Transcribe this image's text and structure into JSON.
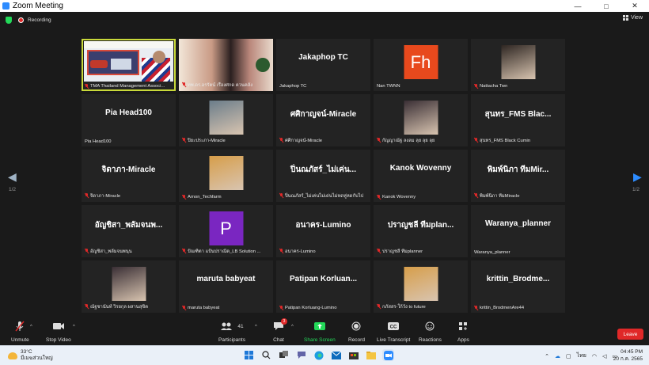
{
  "window": {
    "title": "Zoom Meeting",
    "min": "—",
    "max": "□",
    "close": "✕"
  },
  "topbar": {
    "recording_label": "Recording",
    "view_label": "View"
  },
  "pagination": {
    "left": "1/2",
    "right": "1/2"
  },
  "tiles": [
    {
      "type": "share",
      "name": "TMA Thailand Management Associ..."
    },
    {
      "type": "photo",
      "name": "ทพ.ดร.อรรัตน์ เรืองศกด ควนคลัง"
    },
    {
      "type": "text",
      "big": "Jakaphop TC",
      "name": "Jakaphop TC",
      "muted": false
    },
    {
      "type": "letter",
      "letter": "Fh",
      "color": "#e8491d",
      "name": "Nan TWNN",
      "muted": false
    },
    {
      "type": "photo",
      "name": "Nattacha Twn",
      "muted": true
    },
    {
      "type": "text",
      "big": "Pia Head100",
      "name": "Pia Head100",
      "muted": false
    },
    {
      "type": "photo",
      "name": "ปิยะประภา-Miracle",
      "muted": true
    },
    {
      "type": "text",
      "big": "ศศิกาญจน์-Miracle",
      "name": "ศศิกาญจน์-Miracle",
      "muted": true
    },
    {
      "type": "photo",
      "name": "กัญญาณัฐ ลงลม ลุย ลุย ลุย",
      "muted": true
    },
    {
      "type": "text",
      "big": "สุนทร_FMS Blac...",
      "name": "สุนทร_FMS Black Cumin",
      "muted": true
    },
    {
      "type": "text",
      "big": "จิดาภา-Miracle",
      "name": "จิดาภา-Miracle",
      "muted": true
    },
    {
      "type": "photo",
      "name": "Arnon_Techfarm",
      "muted": true
    },
    {
      "type": "text",
      "big": "ปิ่นณภัสร์_ไม่เค่น...",
      "name": "ปิ่นณภัสร์_ไม่เค่นไม่เด่นไม่หดหู่หดกับไป",
      "muted": true
    },
    {
      "type": "text",
      "big": "Kanok Wovenny",
      "name": "Kanok Wovenny",
      "muted": true
    },
    {
      "type": "text",
      "big": "พิมพ์นิภา ทีมMir...",
      "name": "พิมพ์นิภา ทีมMiracle",
      "muted": true
    },
    {
      "type": "text",
      "big": "อัญชิสา_พลัมจนพ...",
      "name": "อัญชิสา_พลัมจนพนุน",
      "muted": true
    },
    {
      "type": "letter",
      "letter": "P",
      "color": "#7a26c1",
      "name": "ปัณฑิตา แป้นปราณีต_LB Solution ...",
      "muted": true
    },
    {
      "type": "text",
      "big": "อนาคร-Lumino",
      "name": "อนาคร-Lumino",
      "muted": true
    },
    {
      "type": "text",
      "big": "ปราญชลี ทีมplan...",
      "name": "ปราญชลี ทีมplanner",
      "muted": true
    },
    {
      "type": "text",
      "big": "Waranya_planner",
      "name": "Waranya_planner",
      "muted": false
    },
    {
      "type": "photo",
      "name": "ณัฐชานันท์ วิรยกุล ผสานสุขิต",
      "muted": true
    },
    {
      "type": "text",
      "big": "maruta babyeat",
      "name": "maruta babyeat",
      "muted": true
    },
    {
      "type": "text",
      "big": "Patipan Korluan...",
      "name": "Patipan Korluang-Lumino",
      "muted": true
    },
    {
      "type": "photo",
      "name": "กภัสสร-ใก้วัง to future",
      "muted": true
    },
    {
      "type": "text",
      "big": "krittin_Brodme...",
      "name": "krittin_BrodmenAre44",
      "muted": true
    }
  ],
  "toolbar": {
    "unmute": "Unmute",
    "stop_video": "Stop Video",
    "participants": "Participants",
    "participants_count": "41",
    "chat": "Chat",
    "chat_badge": "3",
    "share_screen": "Share Screen",
    "record": "Record",
    "live_transcript": "Live Transcript",
    "reactions": "Reactions",
    "apps": "Apps",
    "leave": "Leave",
    "share_color": "#23d959"
  },
  "taskbar": {
    "temp": "33°C",
    "weather_desc": "มีเมฆส่วนใหญ่",
    "lang": "ไทย",
    "time": "04:45 PM",
    "date": "20 ก.ค. 2565"
  }
}
